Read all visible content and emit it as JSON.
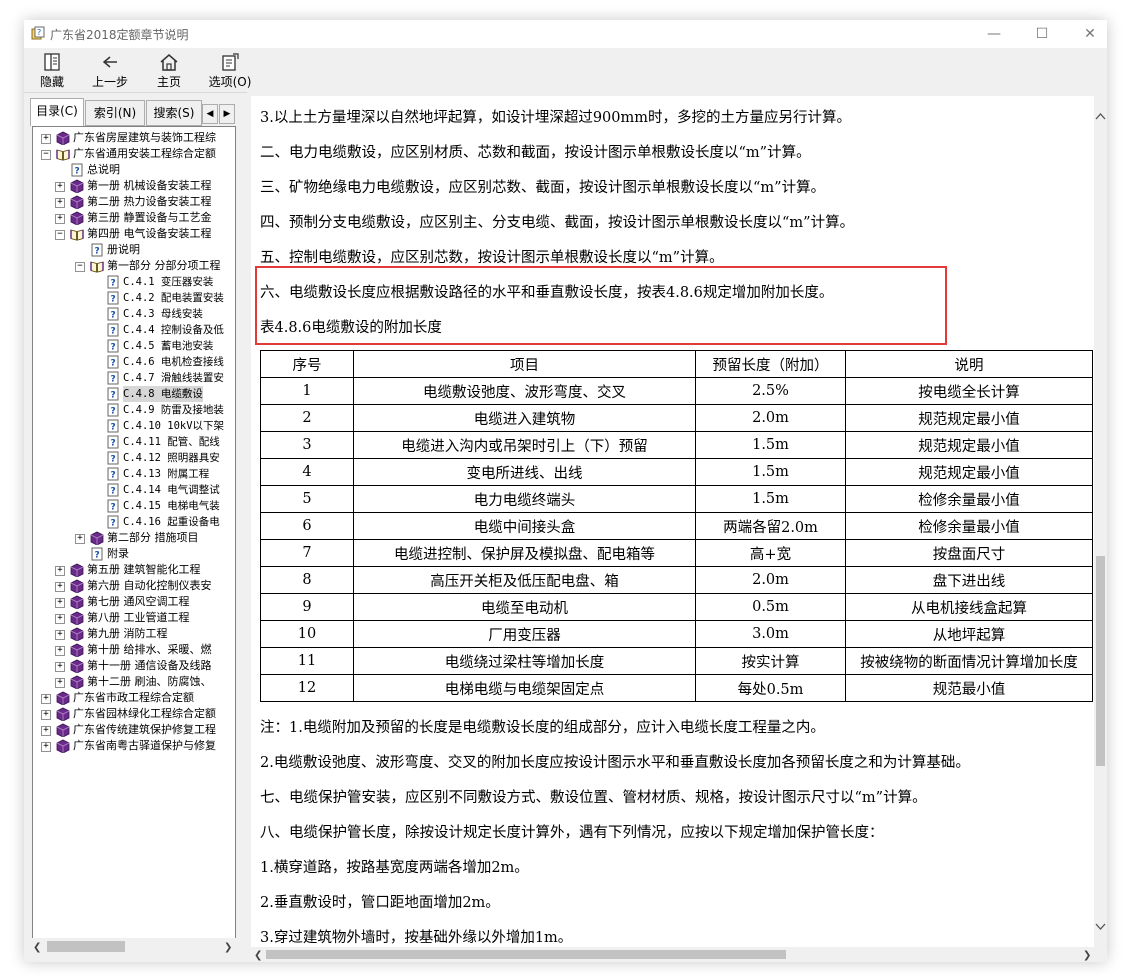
{
  "window": {
    "title": "广东省2018定额章节说明",
    "controls": {
      "minimize": "—",
      "maximize": "☐",
      "close": "✕"
    }
  },
  "toolbar": {
    "buttons": [
      {
        "label": "隐藏",
        "icon": "hide-icon"
      },
      {
        "label": "上一步",
        "icon": "back-arrow-icon"
      },
      {
        "label": "主页",
        "icon": "home-icon"
      },
      {
        "label": "选项(O)",
        "icon": "options-icon"
      }
    ]
  },
  "sidebar": {
    "tabs": [
      "目录(C)",
      "索引(N)",
      "搜索(S)"
    ],
    "tree": [
      {
        "level": 0,
        "type": "book",
        "expander": "+",
        "label": "广东省房屋建筑与装饰工程综"
      },
      {
        "level": 0,
        "type": "book-open",
        "expander": "−",
        "label": "广东省通用安装工程综合定额"
      },
      {
        "level": 1,
        "type": "page",
        "expander": "",
        "label": "总说明"
      },
      {
        "level": 1,
        "type": "book",
        "expander": "+",
        "label": "第一册 机械设备安装工程"
      },
      {
        "level": 1,
        "type": "book",
        "expander": "+",
        "label": "第二册 热力设备安装工程"
      },
      {
        "level": 1,
        "type": "book",
        "expander": "+",
        "label": "第三册 静置设备与工艺金"
      },
      {
        "level": 1,
        "type": "book-open",
        "expander": "−",
        "label": "第四册 电气设备安装工程"
      },
      {
        "level": 2,
        "type": "page",
        "expander": "",
        "label": "册说明"
      },
      {
        "level": 2,
        "type": "book-open",
        "expander": "−",
        "label": "第一部分 分部分项工程"
      },
      {
        "level": 3,
        "type": "page",
        "expander": "",
        "label": "C.4.1 变压器安装"
      },
      {
        "level": 3,
        "type": "page",
        "expander": "",
        "label": "C.4.2 配电装置安装"
      },
      {
        "level": 3,
        "type": "page",
        "expander": "",
        "label": "C.4.3 母线安装"
      },
      {
        "level": 3,
        "type": "page",
        "expander": "",
        "label": "C.4.4 控制设备及低"
      },
      {
        "level": 3,
        "type": "page",
        "expander": "",
        "label": "C.4.5 蓄电池安装"
      },
      {
        "level": 3,
        "type": "page",
        "expander": "",
        "label": "C.4.6 电机检查接线"
      },
      {
        "level": 3,
        "type": "page",
        "expander": "",
        "label": "C.4.7 滑触线装置安"
      },
      {
        "level": 3,
        "type": "page",
        "expander": "",
        "label": "C.4.8 电缆敷设",
        "selected": true
      },
      {
        "level": 3,
        "type": "page",
        "expander": "",
        "label": "C.4.9 防雷及接地装"
      },
      {
        "level": 3,
        "type": "page",
        "expander": "",
        "label": "C.4.10 10kV以下架"
      },
      {
        "level": 3,
        "type": "page",
        "expander": "",
        "label": "C.4.11 配管、配线"
      },
      {
        "level": 3,
        "type": "page",
        "expander": "",
        "label": "C.4.12 照明器具安"
      },
      {
        "level": 3,
        "type": "page",
        "expander": "",
        "label": "C.4.13 附属工程"
      },
      {
        "level": 3,
        "type": "page",
        "expander": "",
        "label": "C.4.14 电气调整试"
      },
      {
        "level": 3,
        "type": "page",
        "expander": "",
        "label": "C.4.15 电梯电气装"
      },
      {
        "level": 3,
        "type": "page",
        "expander": "",
        "label": "C.4.16 起重设备电"
      },
      {
        "level": 2,
        "type": "book",
        "expander": "+",
        "label": "第二部分 措施项目"
      },
      {
        "level": 2,
        "type": "page",
        "expander": "",
        "label": "附录"
      },
      {
        "level": 1,
        "type": "book",
        "expander": "+",
        "label": "第五册 建筑智能化工程"
      },
      {
        "level": 1,
        "type": "book",
        "expander": "+",
        "label": "第六册 自动化控制仪表安"
      },
      {
        "level": 1,
        "type": "book",
        "expander": "+",
        "label": "第七册 通风空调工程"
      },
      {
        "level": 1,
        "type": "book",
        "expander": "+",
        "label": "第八册 工业管道工程"
      },
      {
        "level": 1,
        "type": "book",
        "expander": "+",
        "label": "第九册 消防工程"
      },
      {
        "level": 1,
        "type": "book",
        "expander": "+",
        "label": "第十册 给排水、采暖、燃"
      },
      {
        "level": 1,
        "type": "book",
        "expander": "+",
        "label": "第十一册 通信设备及线路"
      },
      {
        "level": 1,
        "type": "book",
        "expander": "+",
        "label": "第十二册 刷油、防腐蚀、"
      },
      {
        "level": 0,
        "type": "book",
        "expander": "+",
        "label": "广东省市政工程综合定额"
      },
      {
        "level": 0,
        "type": "book",
        "expander": "+",
        "label": "广东省园林绿化工程综合定额"
      },
      {
        "level": 0,
        "type": "book",
        "expander": "+",
        "label": "广东省传统建筑保护修复工程"
      },
      {
        "level": 0,
        "type": "book",
        "expander": "+",
        "label": "广东省南粤古驿道保护与修复"
      }
    ]
  },
  "content": {
    "paragraphs_top": [
      "3.以上土方量埋深以自然地坪起算，如设计埋深超过900mm时，多挖的土方量应另行计算。",
      "二、电力电缆敷设，应区别材质、芯数和截面，按设计图示单根敷设长度以“m”计算。",
      "三、矿物绝缘电力电缆敷设，应区别芯数、截面，按设计图示单根敷设长度以“m”计算。",
      "四、预制分支电缆敷设，应区别主、分支电缆、截面，按设计图示单根敷设长度以“m”计算。",
      "五、控制电缆敷设，应区别芯数，按设计图示单根敷设长度以“m”计算。",
      "六、电缆敷设长度应根据敷设路径的水平和垂直敷设长度，按表4.8.6规定增加附加长度。",
      "表4.8.6电缆敷设的附加长度"
    ],
    "table": {
      "headers": [
        "序号",
        "项目",
        "预留长度（附加）",
        "说明"
      ],
      "rows": [
        [
          "1",
          "电缆敷设弛度、波形弯度、交叉",
          "2.5%",
          "按电缆全长计算"
        ],
        [
          "2",
          "电缆进入建筑物",
          "2.0m",
          "规范规定最小值"
        ],
        [
          "3",
          "电缆进入沟内或吊架时引上（下）预留",
          "1.5m",
          "规范规定最小值"
        ],
        [
          "4",
          "变电所进线、出线",
          "1.5m",
          "规范规定最小值"
        ],
        [
          "5",
          "电力电缆终端头",
          "1.5m",
          "检修余量最小值"
        ],
        [
          "6",
          "电缆中间接头盒",
          "两端各留2.0m",
          "检修余量最小值"
        ],
        [
          "7",
          "电缆进控制、保护屏及模拟盘、配电箱等",
          "高+宽",
          "按盘面尺寸"
        ],
        [
          "8",
          "高压开关柜及低压配电盘、箱",
          "2.0m",
          "盘下进出线"
        ],
        [
          "9",
          "电缆至电动机",
          "0.5m",
          "从电机接线盒起算"
        ],
        [
          "10",
          "厂用变压器",
          "3.0m",
          "从地坪起算"
        ],
        [
          "11",
          "电缆绕过梁柱等增加长度",
          "按实计算",
          "按被绕物的断面情况计算增加长度"
        ],
        [
          "12",
          "电梯电缆与电缆架固定点",
          "每处0.5m",
          "规范最小值"
        ]
      ]
    },
    "paragraphs_bottom": [
      "注：1.电缆附加及预留的长度是电缆敷设长度的组成部分，应计入电缆长度工程量之内。",
      "2.电缆敷设弛度、波形弯度、交叉的附加长度应按设计图示水平和垂直敷设长度加各预留长度之和为计算基础。",
      "七、电缆保护管安装，应区别不同敷设方式、敷设位置、管材材质、规格，按设计图示尺寸以“m”计算。",
      "八、电缆保护管长度，除按设计规定长度计算外，遇有下列情况，应按以下规定增加保护管长度：",
      "1.横穿道路，按路基宽度两端各增加2m。",
      "2.垂直敷设时，管口距地面增加2m。",
      "3.穿过建筑物外墙时，按基础外缘以外增加1m。"
    ],
    "highlight_color": "#e03a3a"
  }
}
